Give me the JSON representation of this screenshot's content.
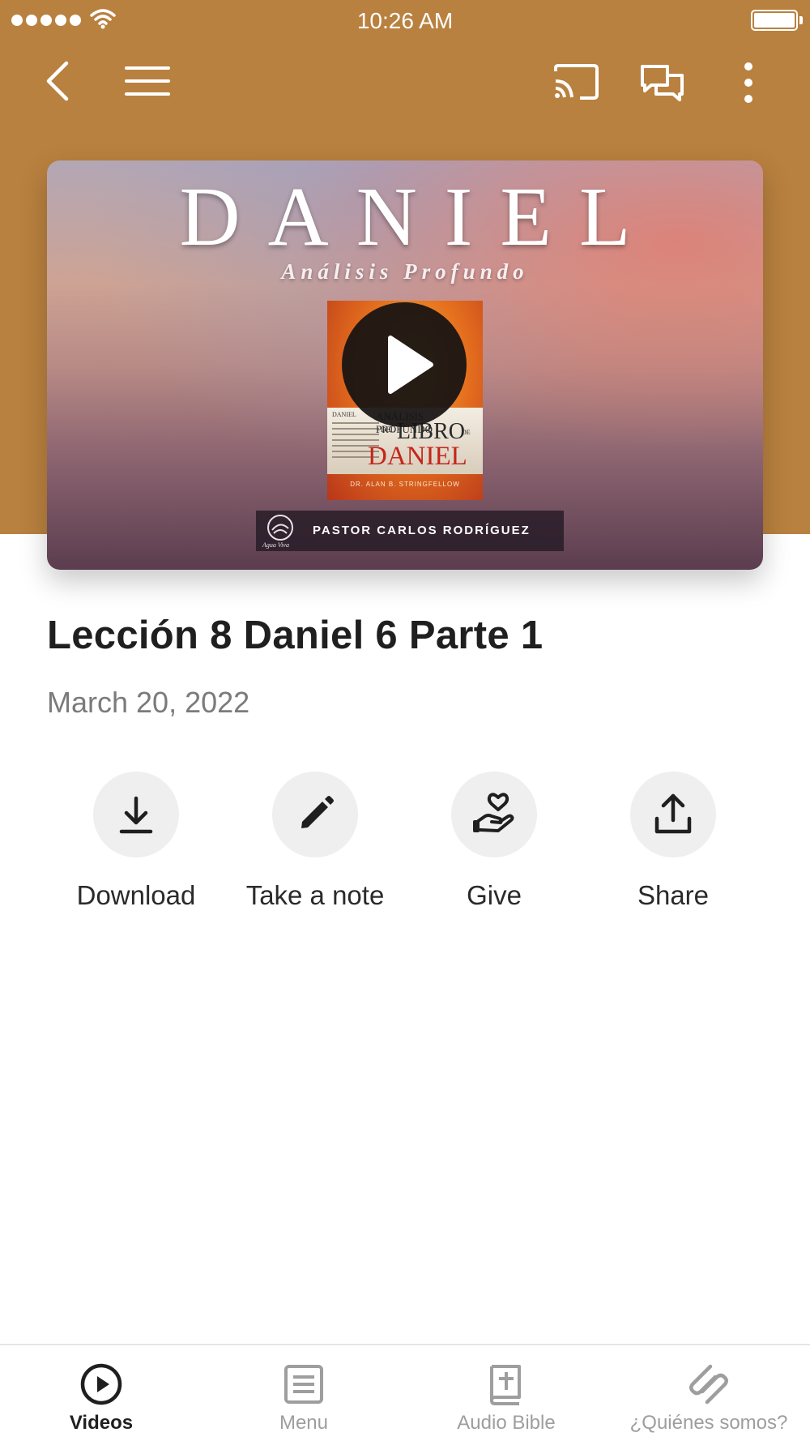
{
  "status_bar": {
    "time": "10:26 AM"
  },
  "colors": {
    "header": "#b9813f",
    "accent": "#1f1f1f",
    "inactive": "#9e9e9e"
  },
  "toolbar": {
    "icons": [
      "back-icon",
      "menu-icon",
      "cast-icon",
      "chat-icon",
      "more-icon"
    ]
  },
  "video": {
    "title": "DANIEL",
    "subtitle": "Análisis Profundo",
    "book": {
      "side_text": "DANIEL",
      "analisis": "ANÁLISIS PROFUNDO",
      "del": "DEL",
      "libro": "LIBRO",
      "de": "DE",
      "daniel": "DANIEL",
      "author": "DR. ALAN B. STRINGFELLOW"
    },
    "logo_text": "Agua Viva",
    "pastor": "PASTOR CARLOS RODRÍGUEZ"
  },
  "lesson": {
    "title": "Lección 8 Daniel 6 Parte 1",
    "date": "March 20, 2022"
  },
  "actions": [
    {
      "label": "Download",
      "icon": "download-icon"
    },
    {
      "label": "Take a note",
      "icon": "pencil-icon"
    },
    {
      "label": "Give",
      "icon": "give-icon"
    },
    {
      "label": "Share",
      "icon": "share-icon"
    }
  ],
  "tabs": [
    {
      "label": "Videos",
      "icon": "play-circle-icon",
      "active": true
    },
    {
      "label": "Menu",
      "icon": "menu-list-icon",
      "active": false
    },
    {
      "label": "Audio Bible",
      "icon": "bible-icon",
      "active": false
    },
    {
      "label": "¿Quiénes somos?",
      "icon": "link-icon",
      "active": false
    }
  ]
}
